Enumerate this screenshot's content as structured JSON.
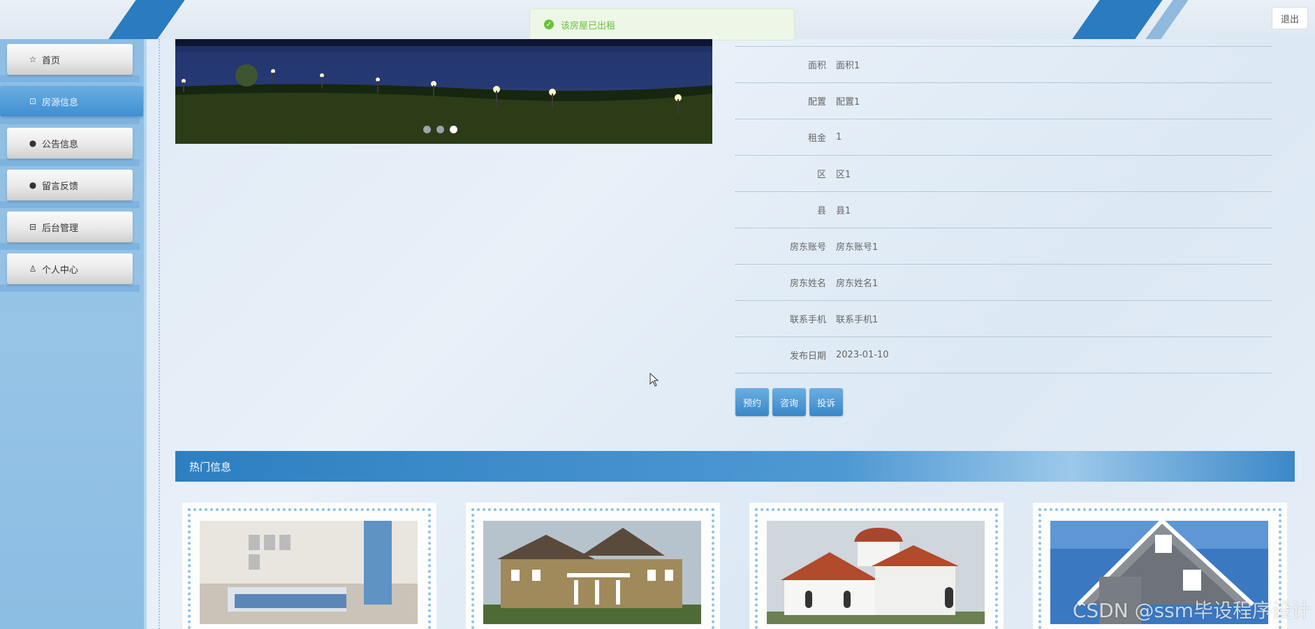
{
  "header": {
    "logout_label": "退出"
  },
  "toast": {
    "message": "该房屋已出租",
    "icon": "check-circle-icon",
    "color": "#67c23a"
  },
  "sidebar": {
    "items": [
      {
        "label": "首页",
        "icon": "star-icon",
        "active": false
      },
      {
        "label": "房源信息",
        "icon": "bag-icon",
        "active": true
      },
      {
        "label": "公告信息",
        "icon": "alert-icon",
        "active": false
      },
      {
        "label": "留言反馈",
        "icon": "question-icon",
        "active": false
      },
      {
        "label": "后台管理",
        "icon": "briefcase-icon",
        "active": false
      },
      {
        "label": "个人中心",
        "icon": "user-icon",
        "active": false
      }
    ]
  },
  "carousel": {
    "slide_count": 3,
    "active_index": 2
  },
  "detail": {
    "rows": [
      {
        "label": "面积",
        "value": "面积1"
      },
      {
        "label": "配置",
        "value": "配置1"
      },
      {
        "label": "租金",
        "value": "1"
      },
      {
        "label": "区",
        "value": "区1"
      },
      {
        "label": "县",
        "value": "县1"
      },
      {
        "label": "房东账号",
        "value": "房东账号1"
      },
      {
        "label": "房东姓名",
        "value": "房东姓名1"
      },
      {
        "label": "联系手机",
        "value": "联系手机1"
      },
      {
        "label": "发布日期",
        "value": "2023-01-10"
      }
    ],
    "actions": {
      "reserve": "预约",
      "consult": "咨询",
      "complain": "投诉"
    }
  },
  "hot": {
    "title": "热门信息"
  },
  "watermark": "CSDN @ssm毕设程序设计",
  "colors": {
    "accent": "#3f8fd1",
    "sidebar": "#8dbde3",
    "header_stripe": "#2a7bbf"
  }
}
